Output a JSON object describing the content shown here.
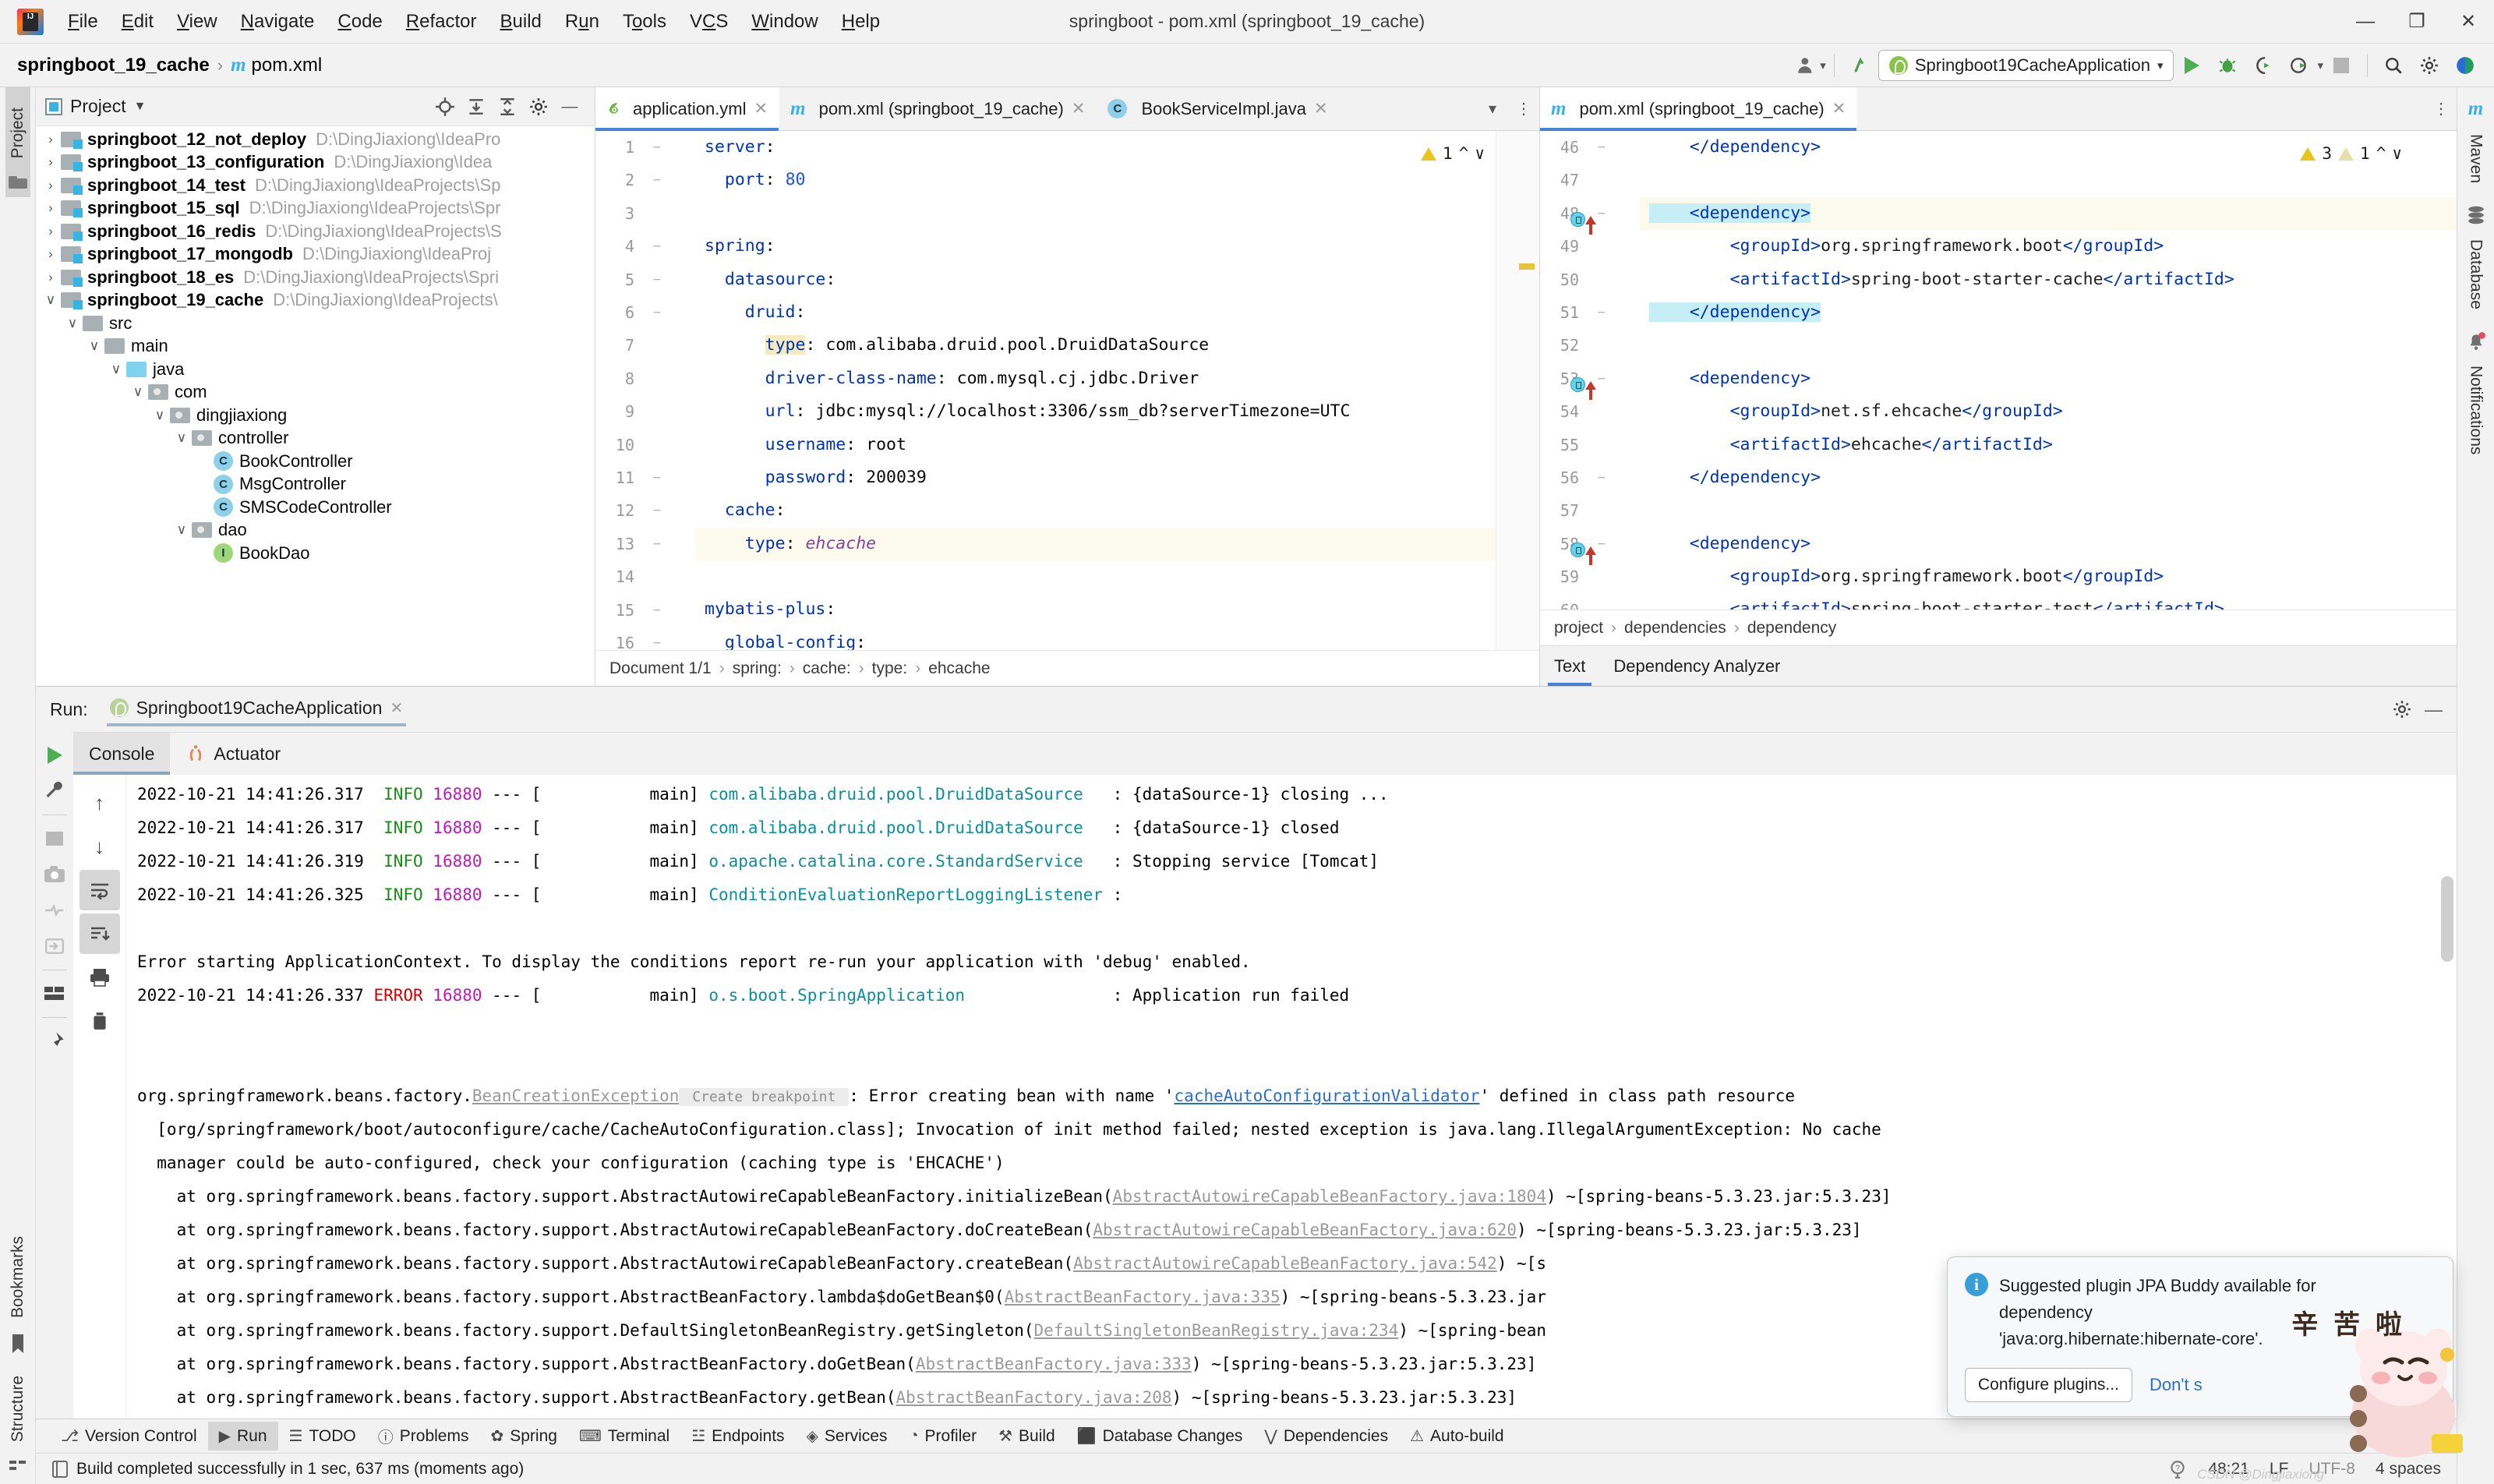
{
  "window": {
    "title": "springboot - pom.xml (springboot_19_cache)",
    "minimize": "—",
    "maximize": "❐",
    "close": "✕"
  },
  "menu": [
    "File",
    "Edit",
    "View",
    "Navigate",
    "Code",
    "Refactor",
    "Build",
    "Run",
    "Tools",
    "VCS",
    "Window",
    "Help"
  ],
  "navbar": {
    "project": "springboot_19_cache",
    "separator": "›",
    "file": "pom.xml",
    "maven_icon": "m",
    "run_config": "Springboot19CacheApplication",
    "icons": [
      "user-avatar-icon",
      "updates-icon",
      "run-icon",
      "debug-icon",
      "run-coverage-icon",
      "profile-icon",
      "stop-icon",
      "search-icon",
      "settings-icon",
      "ide-assistant-icon"
    ]
  },
  "left_strip": [
    {
      "label": "Project",
      "active": true
    },
    {
      "label": "Bookmarks",
      "active": false
    },
    {
      "label": "Structure",
      "active": false
    }
  ],
  "right_strip": [
    {
      "label": "Maven",
      "icon": "maven-icon"
    },
    {
      "label": "Database",
      "icon": "database-icon"
    },
    {
      "label": "Notifications",
      "icon": "bell-icon"
    }
  ],
  "project_panel": {
    "title": "Project",
    "toolbar_icons": [
      "locate-icon",
      "expand-all-icon",
      "collapse-all-icon",
      "settings-icon",
      "hide-icon"
    ],
    "tree": [
      {
        "indent": 0,
        "arrow": "›",
        "icon": "module-folder",
        "name": "springboot_12_not_deploy",
        "path": "D:\\DingJiaxiong\\IdeaPro",
        "bold": true
      },
      {
        "indent": 0,
        "arrow": "›",
        "icon": "module-folder",
        "name": "springboot_13_configuration",
        "path": "D:\\DingJiaxiong\\Idea",
        "bold": true
      },
      {
        "indent": 0,
        "arrow": "›",
        "icon": "module-folder",
        "name": "springboot_14_test",
        "path": "D:\\DingJiaxiong\\IdeaProjects\\Sp",
        "bold": true
      },
      {
        "indent": 0,
        "arrow": "›",
        "icon": "module-folder",
        "name": "springboot_15_sql",
        "path": "D:\\DingJiaxiong\\IdeaProjects\\Spr",
        "bold": true
      },
      {
        "indent": 0,
        "arrow": "›",
        "icon": "module-folder",
        "name": "springboot_16_redis",
        "path": "D:\\DingJiaxiong\\IdeaProjects\\S",
        "bold": true
      },
      {
        "indent": 0,
        "arrow": "›",
        "icon": "module-folder",
        "name": "springboot_17_mongodb",
        "path": "D:\\DingJiaxiong\\IdeaProj",
        "bold": true
      },
      {
        "indent": 0,
        "arrow": "›",
        "icon": "module-folder",
        "name": "springboot_18_es",
        "path": "D:\\DingJiaxiong\\IdeaProjects\\Spri",
        "bold": true
      },
      {
        "indent": 0,
        "arrow": "∨",
        "icon": "module-folder",
        "name": "springboot_19_cache",
        "path": "D:\\DingJiaxiong\\IdeaProjects\\",
        "bold": true
      },
      {
        "indent": 1,
        "arrow": "∨",
        "icon": "folder",
        "name": "src",
        "path": "",
        "bold": false
      },
      {
        "indent": 2,
        "arrow": "∨",
        "icon": "folder",
        "name": "main",
        "path": "",
        "bold": false
      },
      {
        "indent": 3,
        "arrow": "∨",
        "icon": "source-folder",
        "name": "java",
        "path": "",
        "bold": false
      },
      {
        "indent": 4,
        "arrow": "∨",
        "icon": "package",
        "name": "com",
        "path": "",
        "bold": false
      },
      {
        "indent": 5,
        "arrow": "∨",
        "icon": "package",
        "name": "dingjiaxiong",
        "path": "",
        "bold": false
      },
      {
        "indent": 6,
        "arrow": "∨",
        "icon": "package",
        "name": "controller",
        "path": "",
        "bold": false
      },
      {
        "indent": 7,
        "arrow": "",
        "icon": "class",
        "name": "BookController",
        "path": "",
        "bold": false
      },
      {
        "indent": 7,
        "arrow": "",
        "icon": "class",
        "name": "MsgController",
        "path": "",
        "bold": false
      },
      {
        "indent": 7,
        "arrow": "",
        "icon": "class",
        "name": "SMSCodeController",
        "path": "",
        "bold": false
      },
      {
        "indent": 6,
        "arrow": "∨",
        "icon": "package",
        "name": "dao",
        "path": "",
        "bold": false
      },
      {
        "indent": 7,
        "arrow": "",
        "icon": "interface",
        "name": "BookDao",
        "path": "",
        "bold": false
      }
    ]
  },
  "editor_left": {
    "tabs": [
      {
        "label": "application.yml",
        "icon": "spring-yaml-icon",
        "active": true
      },
      {
        "label": "pom.xml (springboot_19_cache)",
        "icon": "maven-icon",
        "active": false
      },
      {
        "label": "BookServiceImpl.java",
        "icon": "class-icon",
        "active": false
      }
    ],
    "warning_count": "1",
    "lines": [
      {
        "n": "1",
        "fold": "−",
        "text": "server:",
        "type": "key-root"
      },
      {
        "n": "2",
        "fold": "−",
        "text": "  port: 80",
        "type": "key-num"
      },
      {
        "n": "3",
        "fold": "",
        "text": "",
        "type": "blank"
      },
      {
        "n": "4",
        "fold": "−",
        "text": "spring:",
        "type": "key-root"
      },
      {
        "n": "5",
        "fold": "−",
        "text": "  datasource:",
        "type": "key"
      },
      {
        "n": "6",
        "fold": "−",
        "text": "    druid:",
        "type": "key"
      },
      {
        "n": "7",
        "fold": "",
        "text": "      type: com.alibaba.druid.pool.DruidDataSource",
        "type": "key-val-hl"
      },
      {
        "n": "8",
        "fold": "",
        "text": "      driver-class-name: com.mysql.cj.jdbc.Driver",
        "type": "key-val"
      },
      {
        "n": "9",
        "fold": "",
        "text": "      url: jdbc:mysql://localhost:3306/ssm_db?serverTimezone=UTC",
        "type": "key-val"
      },
      {
        "n": "10",
        "fold": "",
        "text": "      username: root",
        "type": "key-val"
      },
      {
        "n": "11",
        "fold": "−",
        "text": "      password: 200039",
        "type": "key-val"
      },
      {
        "n": "12",
        "fold": "−",
        "text": "  cache:",
        "type": "key"
      },
      {
        "n": "13",
        "fold": "−",
        "text": "    type: ehcache",
        "type": "key-italic"
      },
      {
        "n": "14",
        "fold": "",
        "text": "",
        "type": "blank"
      },
      {
        "n": "15",
        "fold": "−",
        "text": "mybatis-plus:",
        "type": "key-root"
      },
      {
        "n": "16",
        "fold": "−",
        "text": "  global-config:",
        "type": "key"
      }
    ],
    "breadcrumb": [
      "Document 1/1",
      "spring:",
      "cache:",
      "type:",
      "ehcache"
    ]
  },
  "editor_right": {
    "tabs": [
      {
        "label": "pom.xml (springboot_19_cache)",
        "icon": "maven-icon",
        "active": true
      }
    ],
    "warning_count": "3",
    "weak_warning_count": "1",
    "lines": [
      {
        "n": "46",
        "fold": "−",
        "text": "    </dependency>",
        "mark": ""
      },
      {
        "n": "47",
        "fold": "",
        "text": "",
        "mark": ""
      },
      {
        "n": "48",
        "fold": "−",
        "text": "    <dependency>",
        "mark": "breakpoint"
      },
      {
        "n": "49",
        "fold": "",
        "text": "        <groupId>org.springframework.boot</groupId>",
        "mark": ""
      },
      {
        "n": "50",
        "fold": "",
        "text": "        <artifactId>spring-boot-starter-cache</artifactId>",
        "mark": ""
      },
      {
        "n": "51",
        "fold": "−",
        "text": "    </dependency>",
        "mark": ""
      },
      {
        "n": "52",
        "fold": "",
        "text": "",
        "mark": ""
      },
      {
        "n": "53",
        "fold": "−",
        "text": "    <dependency>",
        "mark": "breakpoint"
      },
      {
        "n": "54",
        "fold": "",
        "text": "        <groupId>net.sf.ehcache</groupId>",
        "mark": ""
      },
      {
        "n": "55",
        "fold": "",
        "text": "        <artifactId>ehcache</artifactId>",
        "mark": ""
      },
      {
        "n": "56",
        "fold": "−",
        "text": "    </dependency>",
        "mark": ""
      },
      {
        "n": "57",
        "fold": "",
        "text": "",
        "mark": ""
      },
      {
        "n": "58",
        "fold": "−",
        "text": "    <dependency>",
        "mark": "breakpoint"
      },
      {
        "n": "59",
        "fold": "",
        "text": "        <groupId>org.springframework.boot</groupId>",
        "mark": ""
      },
      {
        "n": "60",
        "fold": "",
        "text": "        <artifactId>spring-boot-starter-test</artifactId>",
        "mark": ""
      }
    ],
    "breadcrumb": [
      "project",
      "dependencies",
      "dependency"
    ],
    "bottom_tabs": [
      {
        "label": "Text",
        "active": true
      },
      {
        "label": "Dependency Analyzer",
        "active": false
      }
    ]
  },
  "run_panel": {
    "label": "Run:",
    "config_name": "Springboot19CacheApplication",
    "tabs": [
      {
        "label": "Console",
        "active": true,
        "icon": "console-icon"
      },
      {
        "label": "Actuator",
        "active": false,
        "icon": "actuator-icon"
      }
    ],
    "tool_icons_left": [
      "rerun-icon",
      "wrench-icon",
      "stop-icon",
      "camera-icon",
      "thread-dump-icon",
      "import-icon",
      "layout-icon",
      "pin-icon"
    ],
    "tool_icons_console": [
      "scroll-up-icon",
      "scroll-down-icon",
      "soft-wrap-icon",
      "scroll-to-end-icon",
      "print-icon",
      "trash-icon"
    ],
    "header_icons": [
      "settings-icon",
      "hide-icon"
    ],
    "console_lines": [
      {
        "segments": [
          {
            "t": "2022-10-21 14:41:26.317 ",
            "c": "ts"
          },
          {
            "t": " INFO ",
            "c": "info"
          },
          {
            "t": "16880",
            "c": "pid"
          },
          {
            "t": " --- [           main] ",
            "c": "ts"
          },
          {
            "t": "com.alibaba.druid.pool.DruidDataSource",
            "c": "cls"
          },
          {
            "t": "   : {dataSource-1} closing ...",
            "c": "ts"
          }
        ]
      },
      {
        "segments": [
          {
            "t": "2022-10-21 14:41:26.317 ",
            "c": "ts"
          },
          {
            "t": " INFO ",
            "c": "info"
          },
          {
            "t": "16880",
            "c": "pid"
          },
          {
            "t": " --- [           main] ",
            "c": "ts"
          },
          {
            "t": "com.alibaba.druid.pool.DruidDataSource",
            "c": "cls"
          },
          {
            "t": "   : {dataSource-1} closed",
            "c": "ts"
          }
        ]
      },
      {
        "segments": [
          {
            "t": "2022-10-21 14:41:26.319 ",
            "c": "ts"
          },
          {
            "t": " INFO ",
            "c": "info"
          },
          {
            "t": "16880",
            "c": "pid"
          },
          {
            "t": " --- [           main] ",
            "c": "ts"
          },
          {
            "t": "o.apache.catalina.core.StandardService",
            "c": "cls"
          },
          {
            "t": "   : Stopping service [Tomcat]",
            "c": "ts"
          }
        ]
      },
      {
        "segments": [
          {
            "t": "2022-10-21 14:41:26.325 ",
            "c": "ts"
          },
          {
            "t": " INFO ",
            "c": "info"
          },
          {
            "t": "16880",
            "c": "pid"
          },
          {
            "t": " --- [           main] ",
            "c": "ts"
          },
          {
            "t": "ConditionEvaluationReportLoggingListener",
            "c": "cls"
          },
          {
            "t": " : ",
            "c": "ts"
          }
        ]
      },
      {
        "segments": [
          {
            "t": "",
            "c": "ts"
          }
        ]
      },
      {
        "segments": [
          {
            "t": "Error starting ApplicationContext. To display the conditions report re-run your application with 'debug' enabled.",
            "c": "ts"
          }
        ]
      },
      {
        "segments": [
          {
            "t": "2022-10-21 14:41:26.337 ",
            "c": "ts"
          },
          {
            "t": "ERROR ",
            "c": "err"
          },
          {
            "t": "16880",
            "c": "pid"
          },
          {
            "t": " --- [           main] ",
            "c": "ts"
          },
          {
            "t": "o.s.boot.SpringApplication",
            "c": "cls"
          },
          {
            "t": "               : Application run failed",
            "c": "ts"
          }
        ]
      },
      {
        "segments": [
          {
            "t": "",
            "c": "ts"
          }
        ]
      },
      {
        "segments": [
          {
            "t": "",
            "c": "ts"
          }
        ]
      },
      {
        "segments": [
          {
            "t": "org.springframework.beans.factory.",
            "c": "ts"
          },
          {
            "t": "BeanCreationException",
            "c": "gray"
          },
          {
            "t": " Create breakpoint ",
            "c": "chip"
          },
          {
            "t": ": Error creating bean with name '",
            "c": "ts"
          },
          {
            "t": "cacheAutoConfigurationValidator",
            "c": "lnk"
          },
          {
            "t": "' defined in class path resource",
            "c": "ts"
          }
        ]
      },
      {
        "segments": [
          {
            "t": "  [org/springframework/boot/autoconfigure/cache/CacheAutoConfiguration.class]; Invocation of init method failed; nested exception is java.lang.IllegalArgumentException: No cache",
            "c": "ts"
          }
        ]
      },
      {
        "segments": [
          {
            "t": "  manager could be auto-configured, check your configuration (caching type is 'EHCACHE')",
            "c": "ts"
          }
        ]
      },
      {
        "segments": [
          {
            "t": "    at org.springframework.beans.factory.support.AbstractAutowireCapableBeanFactory.initializeBean(",
            "c": "ts"
          },
          {
            "t": "AbstractAutowireCapableBeanFactory.java:1804",
            "c": "gray"
          },
          {
            "t": ") ~[spring-beans-5.3.23.jar:5.3.23]",
            "c": "ts"
          }
        ]
      },
      {
        "segments": [
          {
            "t": "    at org.springframework.beans.factory.support.AbstractAutowireCapableBeanFactory.doCreateBean(",
            "c": "ts"
          },
          {
            "t": "AbstractAutowireCapableBeanFactory.java:620",
            "c": "gray"
          },
          {
            "t": ") ~[spring-beans-5.3.23.jar:5.3.23]",
            "c": "ts"
          }
        ]
      },
      {
        "segments": [
          {
            "t": "    at org.springframework.beans.factory.support.AbstractAutowireCapableBeanFactory.createBean(",
            "c": "ts"
          },
          {
            "t": "AbstractAutowireCapableBeanFactory.java:542",
            "c": "gray"
          },
          {
            "t": ") ~[s",
            "c": "ts"
          }
        ]
      },
      {
        "segments": [
          {
            "t": "    at org.springframework.beans.factory.support.AbstractBeanFactory.lambda$doGetBean$0(",
            "c": "ts"
          },
          {
            "t": "AbstractBeanFactory.java:335",
            "c": "gray"
          },
          {
            "t": ") ~[spring-beans-5.3.23.jar",
            "c": "ts"
          }
        ]
      },
      {
        "segments": [
          {
            "t": "    at org.springframework.beans.factory.support.DefaultSingletonBeanRegistry.getSingleton(",
            "c": "ts"
          },
          {
            "t": "DefaultSingletonBeanRegistry.java:234",
            "c": "gray"
          },
          {
            "t": ") ~[spring-bean",
            "c": "ts"
          }
        ]
      },
      {
        "segments": [
          {
            "t": "    at org.springframework.beans.factory.support.AbstractBeanFactory.doGetBean(",
            "c": "ts"
          },
          {
            "t": "AbstractBeanFactory.java:333",
            "c": "gray"
          },
          {
            "t": ") ~[spring-beans-5.3.23.jar:5.3.23]",
            "c": "ts"
          }
        ]
      },
      {
        "segments": [
          {
            "t": "    at org.springframework.beans.factory.support.AbstractBeanFactory.getBean(",
            "c": "ts"
          },
          {
            "t": "AbstractBeanFactory.java:208",
            "c": "gray"
          },
          {
            "t": ") ~[spring-beans-5.3.23.jar:5.3.23]",
            "c": "ts"
          }
        ]
      }
    ]
  },
  "notification": {
    "title_line1": "Suggested plugin JPA Buddy available for",
    "title_line2": "dependency",
    "title_line3": "'java:org.hibernate:hibernate-core'.",
    "primary_button": "Configure plugins...",
    "secondary_link": "Don't s",
    "info_icon": "i"
  },
  "mascot": {
    "caption": "辛 苦 啦"
  },
  "bottom_toolbar": [
    {
      "label": "Version Control",
      "icon": "branch-icon",
      "active": false
    },
    {
      "label": "Run",
      "icon": "run-icon",
      "active": true
    },
    {
      "label": "TODO",
      "icon": "todo-icon",
      "active": false
    },
    {
      "label": "Problems",
      "icon": "problems-icon",
      "active": false
    },
    {
      "label": "Spring",
      "icon": "spring-icon",
      "active": false
    },
    {
      "label": "Terminal",
      "icon": "terminal-icon",
      "active": false
    },
    {
      "label": "Endpoints",
      "icon": "endpoints-icon",
      "active": false
    },
    {
      "label": "Services",
      "icon": "services-icon",
      "active": false
    },
    {
      "label": "Profiler",
      "icon": "profiler-icon",
      "active": false
    },
    {
      "label": "Build",
      "icon": "build-icon",
      "active": false
    },
    {
      "label": "Database Changes",
      "icon": "database-changes-icon",
      "active": false
    },
    {
      "label": "Dependencies",
      "icon": "dependencies-icon",
      "active": false
    },
    {
      "label": "Auto-build",
      "icon": "auto-build-icon",
      "active": false
    }
  ],
  "status_bar": {
    "message": "Build completed successfully in 1 sec, 637 ms (moments ago)",
    "caret": "48:21",
    "line_sep": "LF",
    "encoding": "UTF-8",
    "indent": "4 spaces",
    "watermark": "CSDN @Dingjiaxiong"
  }
}
